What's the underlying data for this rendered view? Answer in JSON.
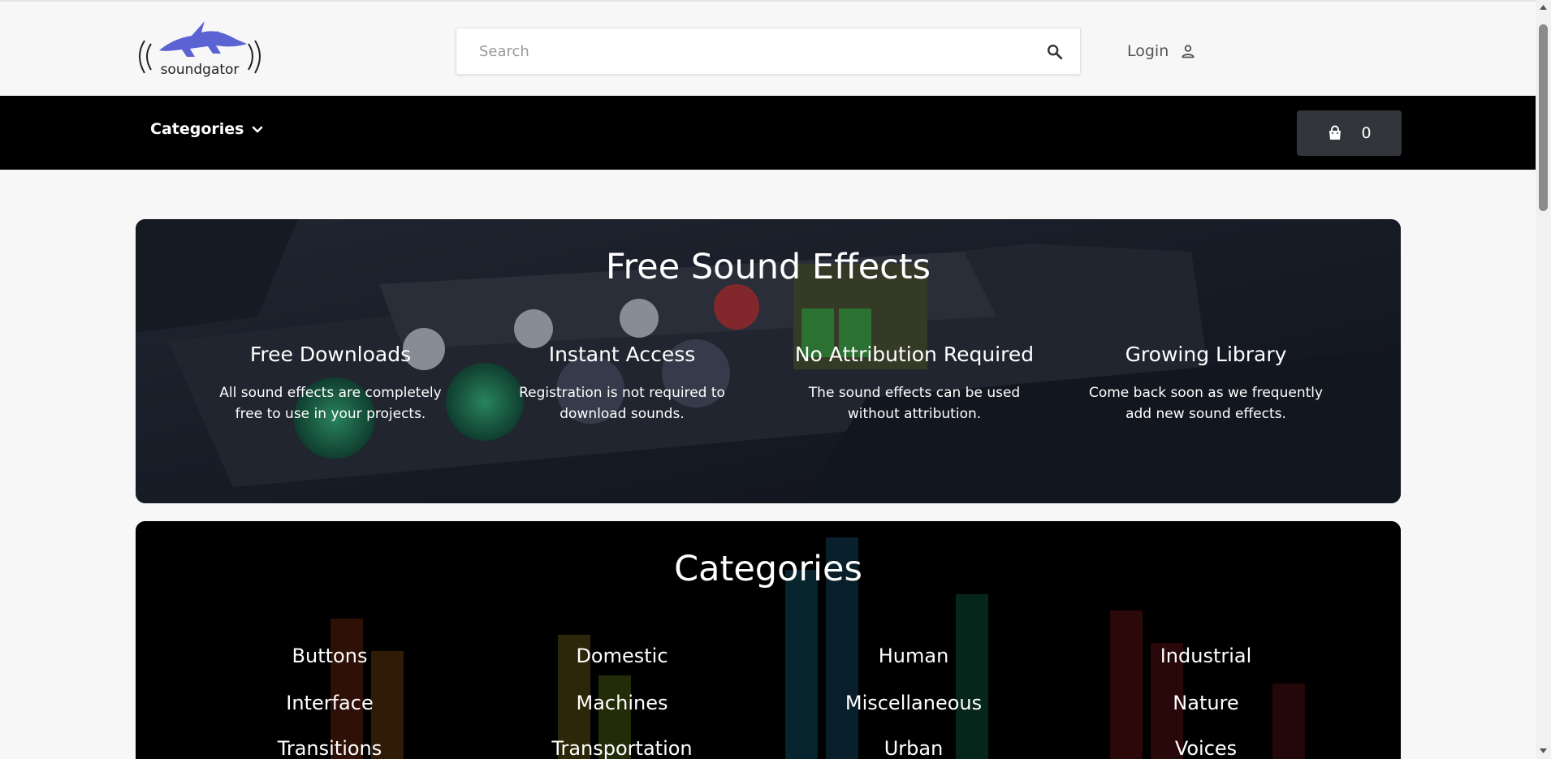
{
  "header": {
    "logo_text": "soundgator",
    "search_placeholder": "Search",
    "login_label": "Login"
  },
  "nav": {
    "categories_label": "Categories",
    "cart_count": "0"
  },
  "hero": {
    "title": "Free Sound Effects",
    "features": [
      {
        "title": "Free Downloads",
        "text": "All sound effects are completely free to use in your projects."
      },
      {
        "title": "Instant Access",
        "text": "Registration is not required to download sounds."
      },
      {
        "title": "No Attribution Required",
        "text": "The sound effects can be used without attribution."
      },
      {
        "title": "Growing Library",
        "text": "Come back soon as we frequently add new sound effects."
      }
    ]
  },
  "categories": {
    "title": "Categories",
    "items": [
      "Buttons",
      "Domestic",
      "Human",
      "Industrial",
      "Interface",
      "Machines",
      "Miscellaneous",
      "Nature",
      "Transitions",
      "Transportation",
      "Urban",
      "Voices"
    ]
  },
  "colors": {
    "page_bg": "#f7f7f7",
    "navbar_bg": "#000000",
    "cart_bg": "#32363b",
    "logo_blue": "#5b63d3"
  },
  "icons": [
    "logo-gator-icon",
    "search-icon",
    "user-icon",
    "chevron-down-icon",
    "shopping-bag-icon"
  ]
}
